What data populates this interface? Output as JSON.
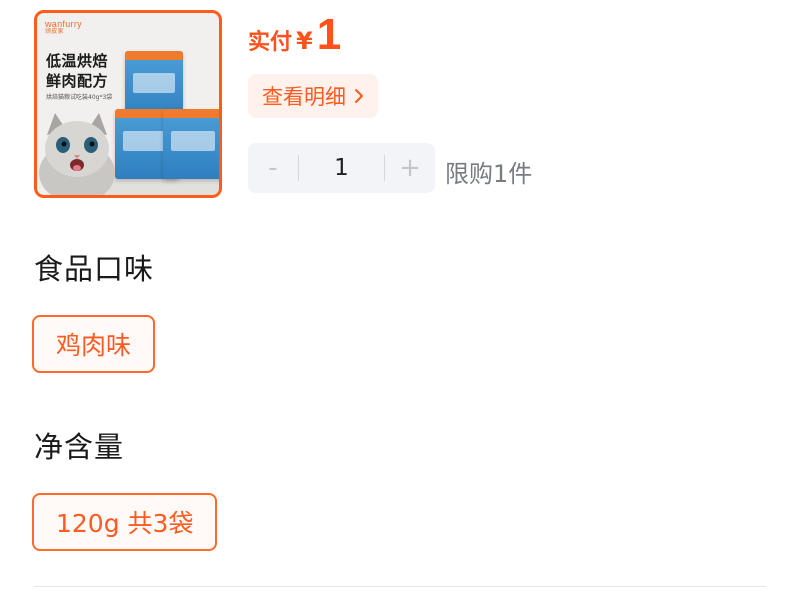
{
  "product": {
    "image_brand": "wanfurry",
    "image_brand_cn": "顽皮家",
    "image_headline_line1": "低温烘焙",
    "image_headline_line2": "鲜肉配方",
    "image_subtitle": "烘焙猫粮试吃装40g*3袋"
  },
  "price": {
    "label": "实付",
    "currency": "¥",
    "amount": "1"
  },
  "detail_button": {
    "label": "查看明细"
  },
  "quantity": {
    "minus": "-",
    "value": "1",
    "plus": "+",
    "limit_text": "限购1件"
  },
  "specs": [
    {
      "title": "食品口味",
      "options": [
        "鸡肉味"
      ]
    },
    {
      "title": "净含量",
      "options": [
        "120g 共3袋"
      ]
    }
  ],
  "colors": {
    "accent": "#ff5119",
    "option_border": "#ff6a2a",
    "detail_bg": "#fff1eb",
    "stepper_bg": "#f3f4f7"
  },
  "icons": {
    "detail_arrow": "chevron-right-icon"
  }
}
